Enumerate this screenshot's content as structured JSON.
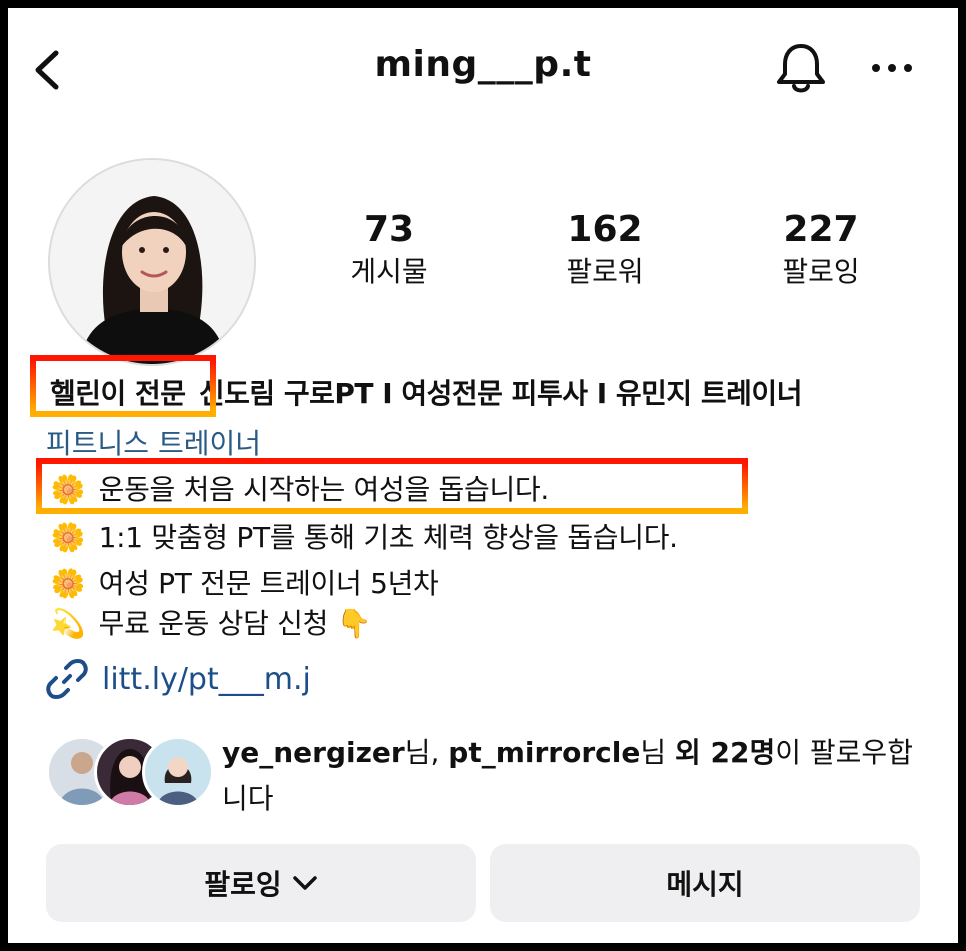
{
  "header": {
    "username": "ming___p.t"
  },
  "stats": [
    {
      "value": "73",
      "label": "게시물"
    },
    {
      "value": "162",
      "label": "팔로워"
    },
    {
      "value": "227",
      "label": "팔로잉"
    }
  ],
  "bio": {
    "name_tag": "헬린이 전문",
    "name_rest": "신도림 구로PT I 여성전문 피투사 I 유민지 트레이너",
    "category": "피트니스 트레이너",
    "lines": [
      {
        "emoji": "🌼",
        "text": "운동을 처음 시작하는 여성을 돕습니다."
      },
      {
        "emoji": "🌼",
        "text": "1:1 맞춤형 PT를 통해 기초 체력 향상을 돕습니다."
      },
      {
        "emoji": "🌼",
        "text": "여성 PT 전문 트레이너 5년차"
      },
      {
        "emoji": "💫",
        "text": "무료 운동 상담 신청 👇"
      }
    ],
    "link": "litt.ly/pt___m.j"
  },
  "followed_by": {
    "user1": "ye_nergizer",
    "suffix1": "님, ",
    "user2": "pt_mirrorcle",
    "suffix2": "님 ",
    "others": "외 22명",
    "tail": "이 팔로우합니다"
  },
  "buttons": {
    "following": "팔로잉",
    "message": "메시지"
  },
  "colors": {
    "link": "#1d4e89",
    "category": "#2a5b86",
    "highlight_top": "#ff1500",
    "highlight_bottom": "#ffb000",
    "button_bg": "#efeff1"
  },
  "icons": [
    "back-arrow-icon",
    "bell-icon",
    "more-icon",
    "link-icon",
    "chevron-down-icon"
  ]
}
